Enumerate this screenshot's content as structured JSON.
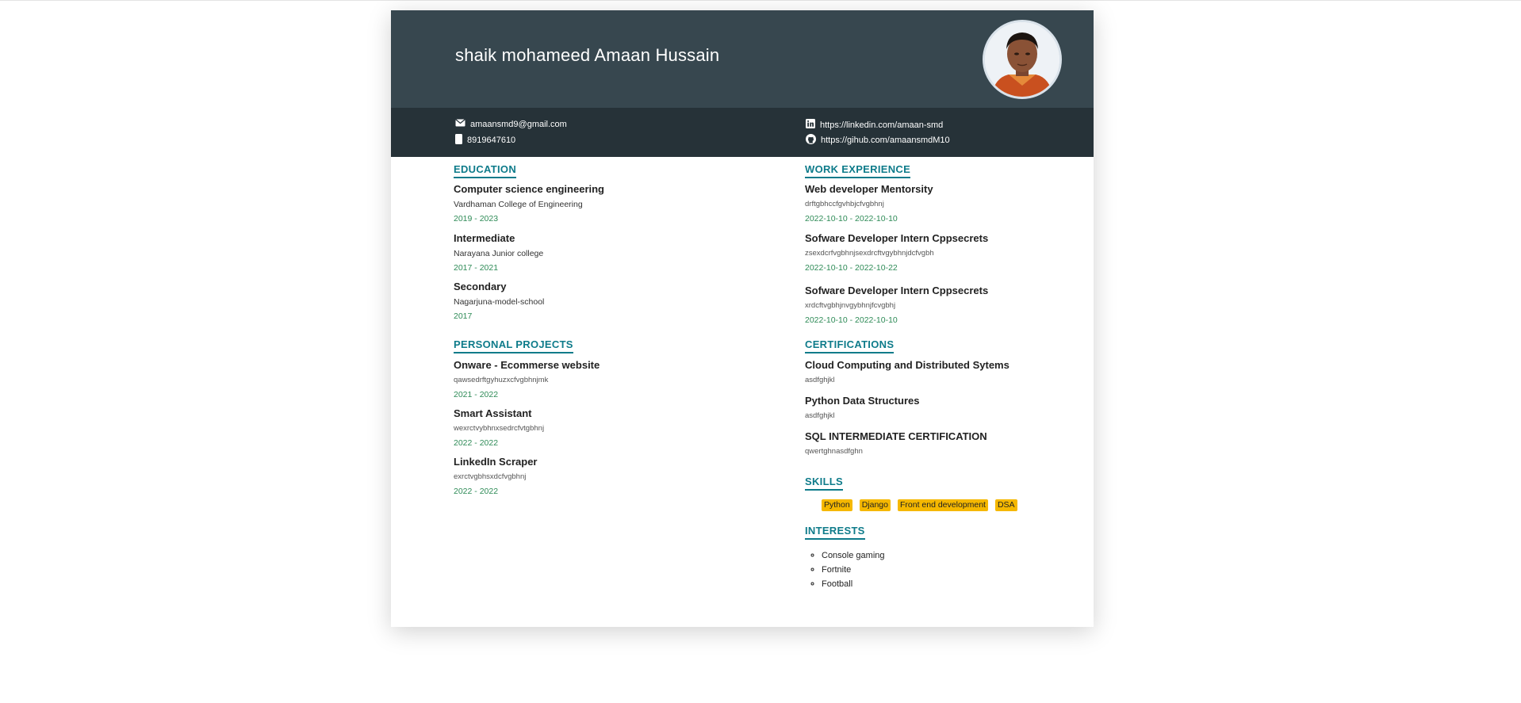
{
  "profile": {
    "name": "shaik mohameed Amaan Hussain",
    "email": "amaansmd9@gmail.com",
    "phone": "8919647610",
    "linkedin": "https://linkedin.com/amaan-smd",
    "github": "https://gihub.com/amaansmdM10"
  },
  "education": {
    "title": "EDUCATION",
    "items": [
      {
        "degree": "Computer science engineering",
        "school": "Vardhaman College of Engineering",
        "dates": "2019 - 2023"
      },
      {
        "degree": "Intermediate",
        "school": "Narayana Junior college",
        "dates": "2017 - 2021"
      },
      {
        "degree": "Secondary",
        "school": "Nagarjuna-model-school",
        "dates": "2017"
      }
    ]
  },
  "projects": {
    "title": "PERSONAL PROJECTS",
    "items": [
      {
        "name": "Onware - Ecommerse website",
        "desc": "qawsedrftgyhuzxcfvgbhnjmk",
        "dates": "2021 - 2022"
      },
      {
        "name": "Smart Assistant",
        "desc": "wexrctvybhnxsedrcfvtgbhnj",
        "dates": "2022 - 2022"
      },
      {
        "name": "LinkedIn Scraper",
        "desc": "exrctvgbhsxdcfvgbhnj",
        "dates": "2022 - 2022"
      }
    ]
  },
  "work": {
    "title": "WORK EXPERIENCE",
    "items": [
      {
        "role": "Web developer Mentorsity",
        "desc": "drftgbhccfgvhbjcfvgbhnj",
        "dates": "2022-10-10 - 2022-10-10"
      },
      {
        "role": "Sofware Developer Intern Cppsecrets",
        "desc": "zsexdcrfvgbhnjsexdrcftvgybhnjdcfvgbh",
        "dates": "2022-10-10 - 2022-10-22"
      },
      {
        "role": "Sofware Developer Intern Cppsecrets",
        "desc": "xrdcftvgbhjnvgybhnjfcvgbhj",
        "dates": "2022-10-10 - 2022-10-10"
      }
    ]
  },
  "certifications": {
    "title": "CERTIFICATIONS",
    "items": [
      {
        "name": "Cloud Computing and Distributed Sytems",
        "desc": "asdfghjkl"
      },
      {
        "name": "Python Data Structures",
        "desc": "asdfghjkl"
      },
      {
        "name": "SQL INTERMEDIATE CERTIFICATION",
        "desc": "qwertghnasdfghn"
      }
    ]
  },
  "skills": {
    "title": "SKILLS",
    "items": [
      "Python",
      "Django",
      "Front end development",
      "DSA"
    ]
  },
  "interests": {
    "title": "INTERESTS",
    "items": [
      "Console gaming",
      "Fortnite",
      "Football"
    ]
  },
  "colors": {
    "header_bg": "#37474f",
    "contact_bg": "#263238",
    "section_accent": "#0e7b8a",
    "date_green": "#2e8b57",
    "skill_badge": "#f5b800"
  }
}
